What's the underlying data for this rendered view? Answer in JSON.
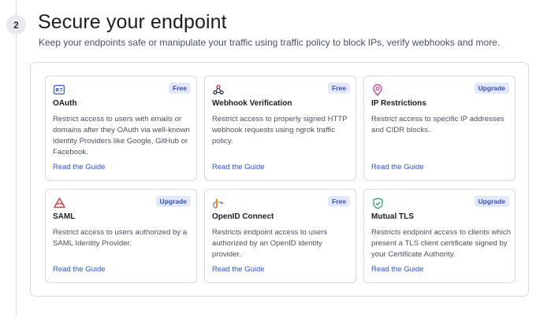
{
  "step": {
    "number": "2"
  },
  "header": {
    "title": "Secure your endpoint",
    "subtitle": "Keep your endpoints safe or manipulate your traffic using traffic policy to block IPs, verify webhooks and more."
  },
  "colors": {
    "link": "#2f56d2",
    "badge_bg": "#e3e8fb",
    "badge_text": "#3451c4",
    "icon_accent": "#3b5bd6",
    "saml_red": "#d43d3d",
    "openid_orange": "#f08a1c",
    "ip_pink": "#d13b8a",
    "tls_green": "#2ea35a"
  },
  "cards": [
    {
      "icon": "oauth-icon",
      "badge": "Free",
      "title": "OAuth",
      "desc": "Restrict access to users with emails or domains after they OAuth via well-known Identity Providers like Google, GitHub or Facebook.",
      "link": "Read the Guide"
    },
    {
      "icon": "webhook-icon",
      "badge": "Free",
      "title": "Webhook Verification",
      "desc": "Restrict access to properly signed HTTP webhook requests using ngrok traffic policy.",
      "link": "Read the Guide"
    },
    {
      "icon": "location-pin-icon",
      "badge": "Upgrade",
      "title": "IP Restrictions",
      "desc": "Restrict access to specific IP addresses and CIDR blocks.",
      "link": "Read the Guide"
    },
    {
      "icon": "saml-icon",
      "badge": "Upgrade",
      "title": "SAML",
      "desc": "Restrict access to users authorized by a SAML Identity Provider.",
      "link": "Read the Guide"
    },
    {
      "icon": "openid-icon",
      "badge": "Free",
      "title": "OpenID Connect",
      "desc": "Restricts endpoint access to users authorized by an OpenID identity provider.",
      "link": "Read the Guide"
    },
    {
      "icon": "shield-check-icon",
      "badge": "Upgrade",
      "title": "Mutual TLS",
      "desc": "Restricts endpoint access to clients which present a TLS client certificate signed by your Certificate Authority.",
      "link": "Read the Guide"
    }
  ]
}
